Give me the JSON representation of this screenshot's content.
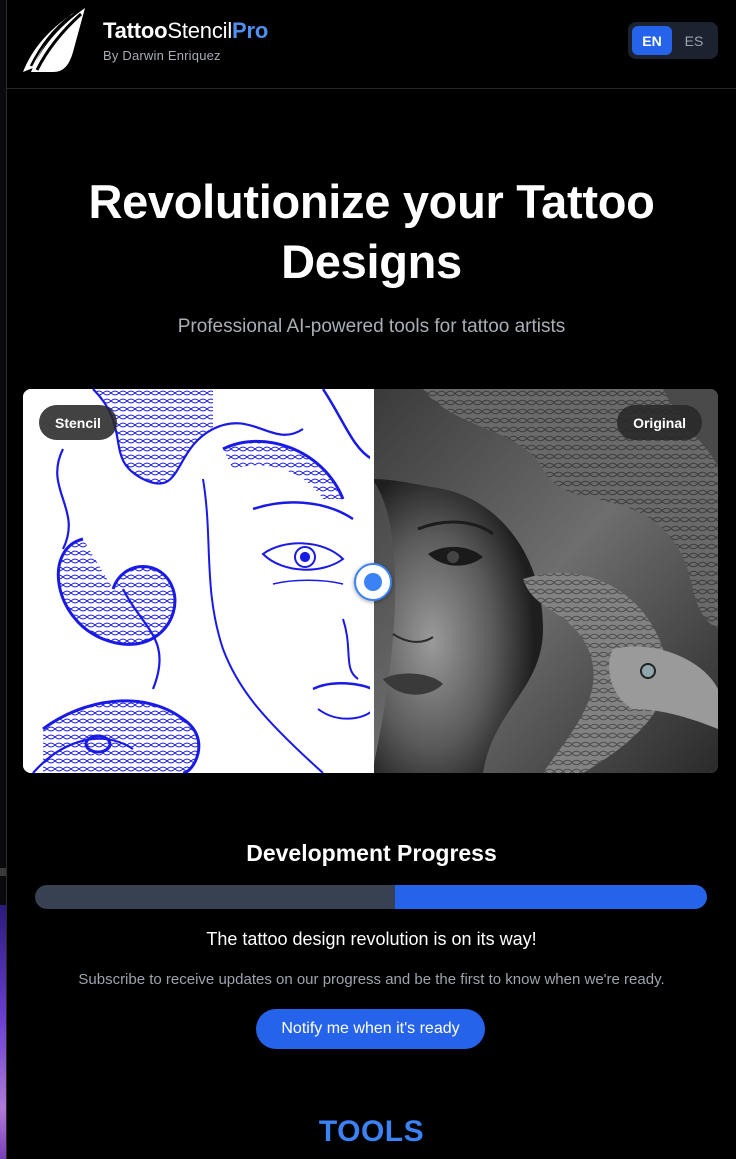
{
  "brand": {
    "name_part1": "Tattoo",
    "name_part2": "Stencil",
    "name_part3": "Pro",
    "byline": "By Darwin Enriquez",
    "accent": "#4f8ff0"
  },
  "language": {
    "options": [
      "EN",
      "ES"
    ],
    "selected": "EN"
  },
  "hero": {
    "title_line1": "Revolutionize your Tattoo",
    "title_line2": "Designs",
    "subtitle": "Professional AI-powered tools for tattoo artists"
  },
  "comparison": {
    "left_label": "Stencil",
    "right_label": "Original",
    "slider_position": 0.5
  },
  "progress": {
    "title": "Development Progress",
    "fill_start_fraction": 0.536,
    "message": "The tattoo design revolution is on its way!",
    "subtext": "Subscribe to receive updates on our progress and be the first to know when we're ready.",
    "button_label": "Notify me when it's ready"
  },
  "sections": {
    "tools_heading": "TOOLS"
  },
  "colors": {
    "primary": "#2563eb",
    "track": "#374151",
    "stencil_ink": "#1a1ae6",
    "background": "#000000"
  }
}
